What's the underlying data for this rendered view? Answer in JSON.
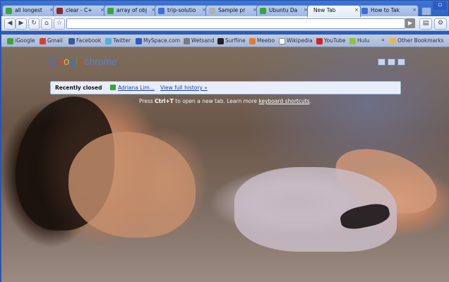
{
  "tabs": [
    {
      "label": "all longest",
      "color": "#3aa33a",
      "active": false
    },
    {
      "label": "clear - C+",
      "color": "#8a2a2a",
      "active": false
    },
    {
      "label": "array of obj",
      "color": "#3aa33a",
      "active": false
    },
    {
      "label": "trip-solutio",
      "color": "#3b6fd8",
      "active": false
    },
    {
      "label": "Sample pr",
      "color": "#b0b0b0",
      "active": false
    },
    {
      "label": "Ubuntu Da",
      "color": "#3aa33a",
      "active": false
    },
    {
      "label": "New Tab",
      "color": "#e6ecf7",
      "active": true
    },
    {
      "label": "How to Tak",
      "color": "#3b6fd8",
      "active": false
    }
  ],
  "bookmarks": [
    {
      "label": "iGoogle",
      "color": "#3aa33a"
    },
    {
      "label": "Gmail",
      "color": "#d84030"
    },
    {
      "label": "Facebook",
      "color": "#3b5998"
    },
    {
      "label": "Twitter",
      "color": "#4fb1e0"
    },
    {
      "label": "MySpace.com",
      "color": "#2a5bc0"
    },
    {
      "label": "Wetsand",
      "color": "#7a7a7a"
    },
    {
      "label": "Surfline",
      "color": "#222222"
    },
    {
      "label": "Meebo",
      "color": "#e47c2c"
    },
    {
      "label": "Wikipedia",
      "color": "#ffffff"
    },
    {
      "label": "YouTube",
      "color": "#d42020"
    },
    {
      "label": "Hulu",
      "color": "#8cc43c"
    }
  ],
  "other_bookmarks": "Other Bookmarks",
  "more_glyph": "»",
  "logo": {
    "g": "G",
    "o1": "o",
    "o2": "o",
    "g2": "g",
    "l": "l",
    "e": "e",
    "chrome": "chrome"
  },
  "recently_closed": {
    "label": "Recently closed",
    "item": "Adriana Lim...",
    "view_history": "View full history »"
  },
  "hint": {
    "pre": "Press ",
    "key": "Ctrl+T",
    "mid": " to open a new tab. Learn more ",
    "link": "keyboard shortcuts",
    "post": "."
  }
}
